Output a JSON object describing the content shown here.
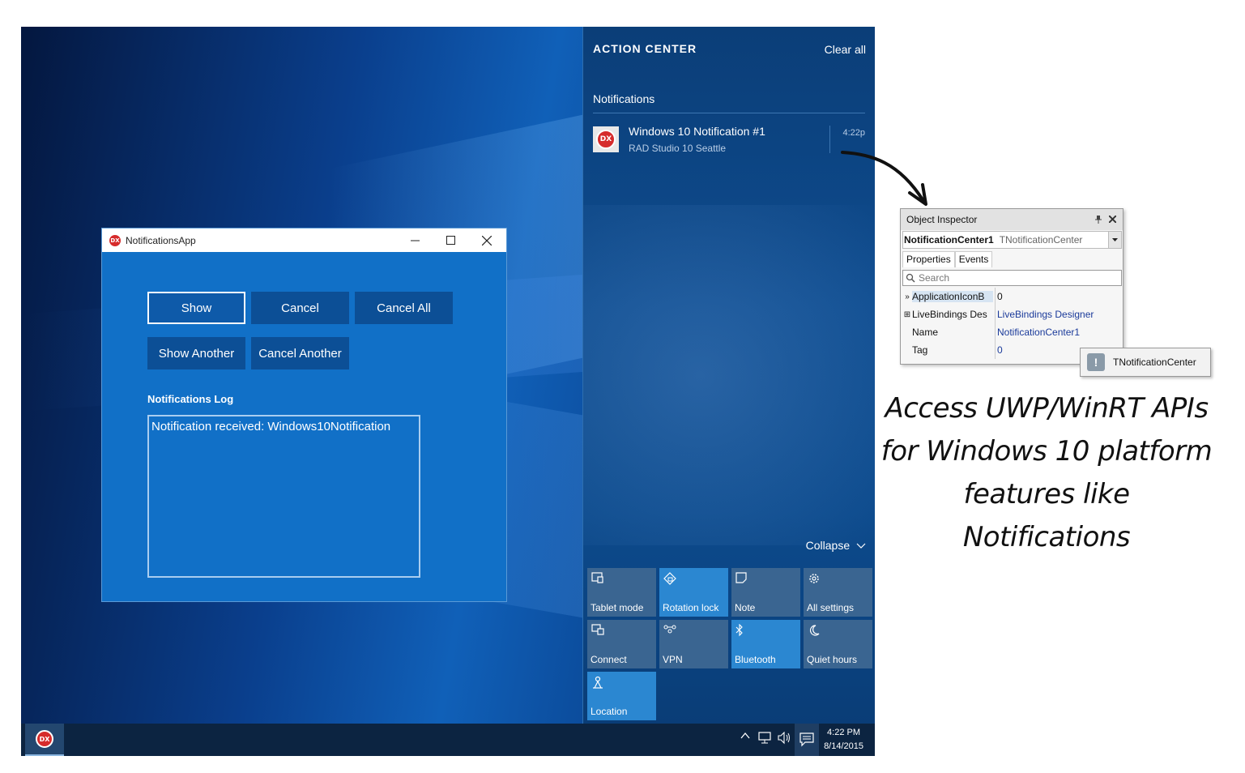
{
  "app_window": {
    "title": "NotificationsApp",
    "buttons": {
      "show": "Show",
      "cancel": "Cancel",
      "cancel_all": "Cancel All",
      "show_another": "Show Another",
      "cancel_another": "Cancel Another"
    },
    "log_label": "Notifications Log",
    "log_text": "Notification received: Windows10Notification"
  },
  "action_center": {
    "header": "ACTION CENTER",
    "clear_all": "Clear all",
    "notifications_header": "Notifications",
    "notification": {
      "icon": "DX",
      "title": "Windows 10 Notification #1",
      "source": "RAD Studio 10 Seattle",
      "time": "4:22p"
    },
    "collapse": "Collapse",
    "tiles": [
      {
        "label": "Tablet mode",
        "icon": "tablet-mode-icon",
        "on": false
      },
      {
        "label": "Rotation lock",
        "icon": "rotation-lock-icon",
        "on": true
      },
      {
        "label": "Note",
        "icon": "note-icon",
        "on": false
      },
      {
        "label": "All settings",
        "icon": "gear-icon",
        "on": false
      },
      {
        "label": "Connect",
        "icon": "connect-icon",
        "on": false
      },
      {
        "label": "VPN",
        "icon": "vpn-icon",
        "on": false
      },
      {
        "label": "Bluetooth",
        "icon": "bluetooth-icon",
        "on": true
      },
      {
        "label": "Quiet hours",
        "icon": "moon-icon",
        "on": false
      },
      {
        "label": "Location",
        "icon": "location-icon",
        "on": true
      }
    ]
  },
  "taskbar": {
    "app_icon": "DX",
    "time": "4:22 PM",
    "date": "8/14/2015"
  },
  "object_inspector": {
    "title": "Object Inspector",
    "component_name": "NotificationCenter1",
    "component_type": "TNotificationCenter",
    "tabs": [
      "Properties",
      "Events"
    ],
    "search_placeholder": "Search",
    "rows": [
      {
        "name": "ApplicationIconB",
        "value": "0"
      },
      {
        "name": "LiveBindings Des",
        "value": "LiveBindings Designer"
      },
      {
        "name": "Name",
        "value": "NotificationCenter1"
      },
      {
        "name": "Tag",
        "value": "0"
      }
    ]
  },
  "tooltip": {
    "text": "TNotificationCenter"
  },
  "annotation": {
    "line1": "Access UWP/WinRT APIs",
    "line2": "for Windows 10 platform",
    "line3": "features like Notifications"
  },
  "colors": {
    "accent": "#1170c7",
    "button": "#0c4f96",
    "tile_on": "#2b87d1",
    "tile_off": "#3a6591"
  }
}
